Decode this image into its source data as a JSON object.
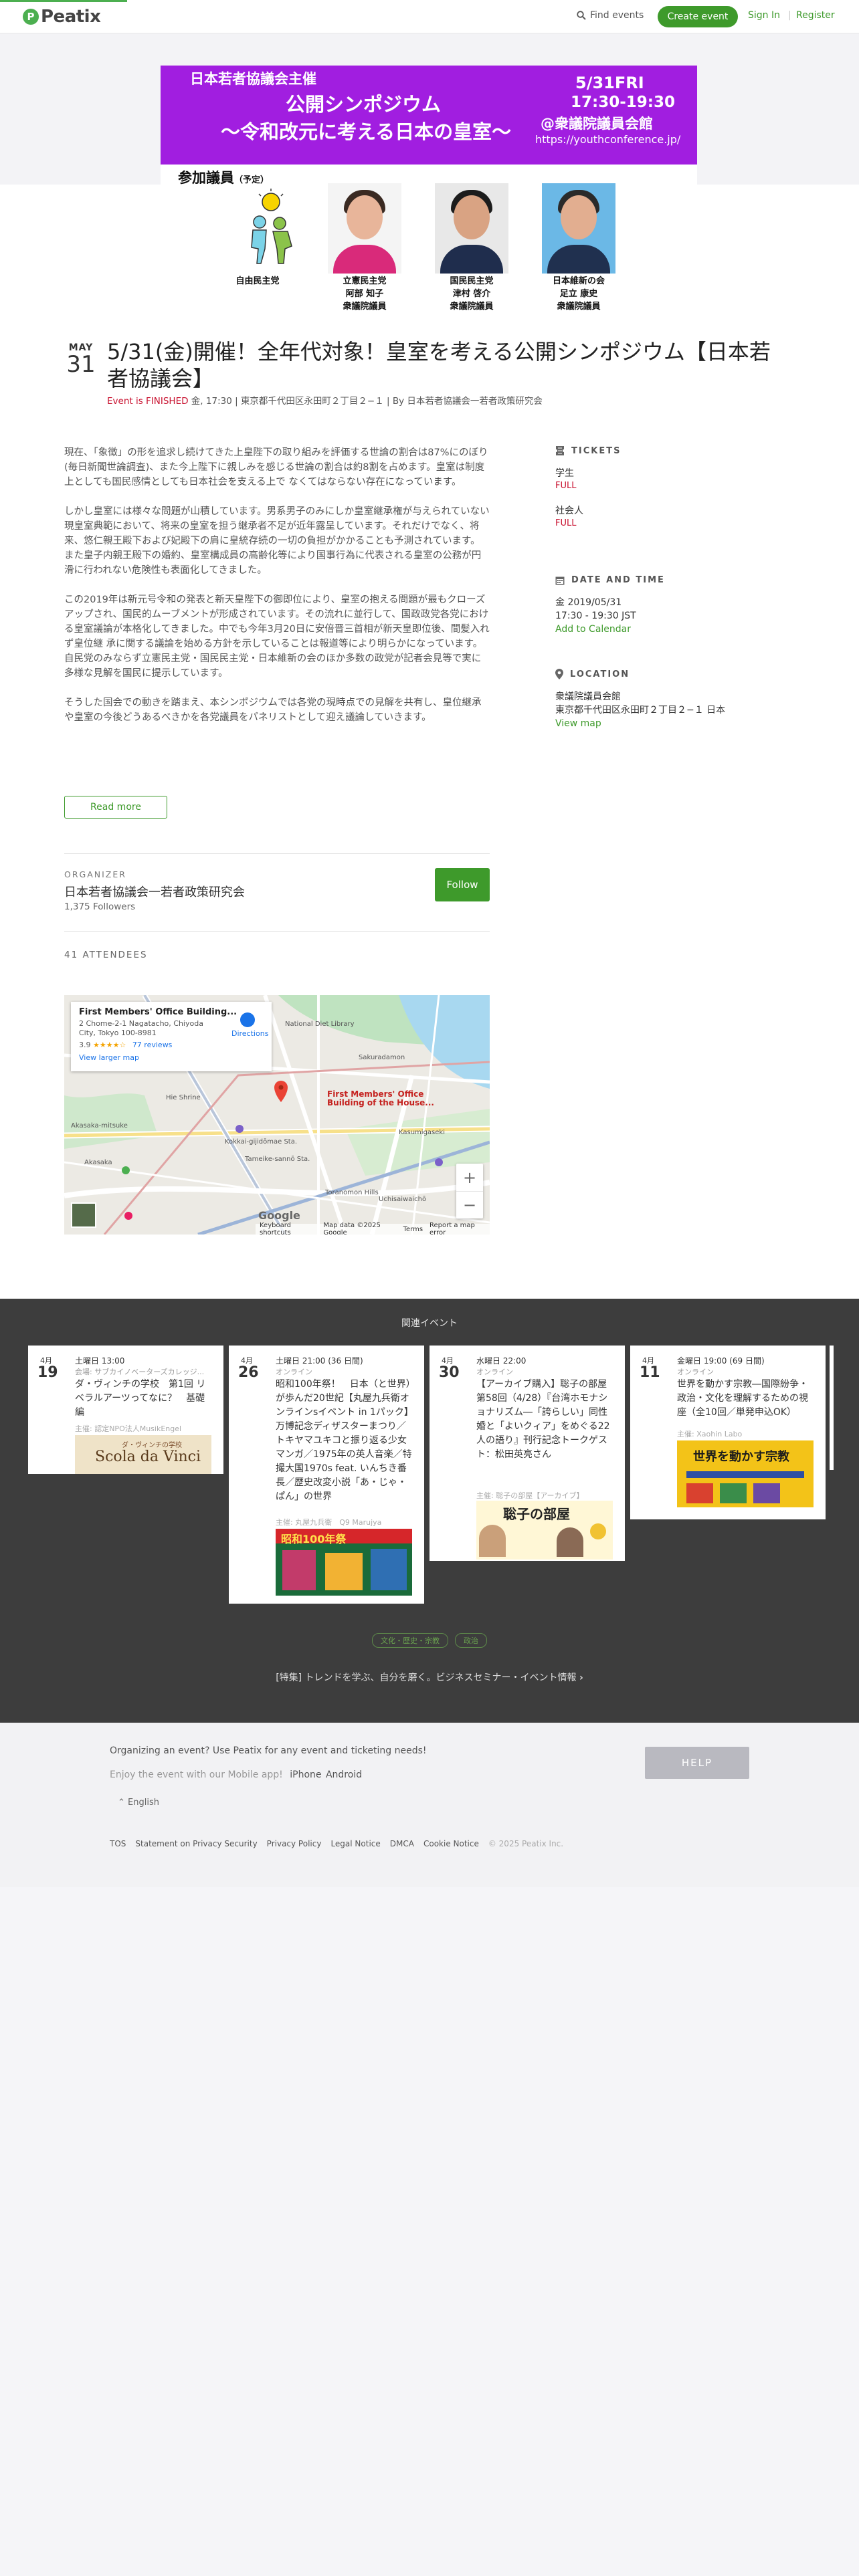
{
  "header": {
    "logo_text": "Peatix",
    "find_events": "Find events",
    "create_event": "Create event",
    "sign_in": "Sign In",
    "separator": "|",
    "register": "Register"
  },
  "banner": {
    "organizer": "日本若者協議会主催",
    "title_line1": "公開シンポジウム",
    "title_line2": "～令和改元に考える日本の皇室～",
    "date": "5/31FRI",
    "time": "17:30-19:30",
    "venue": "@衆議院議員会館",
    "url": "https://youthconference.jp/",
    "members_heading": "参加議員",
    "members_sub": "（予定）",
    "members": [
      {
        "party": "自由民主党",
        "name": "",
        "role": ""
      },
      {
        "party": "立憲民主党",
        "name": "阿部 知子",
        "role": "衆議院議員"
      },
      {
        "party": "国民民主党",
        "name": "津村 啓介",
        "role": "衆議院議員"
      },
      {
        "party": "日本維新の会",
        "name": "足立 康史",
        "role": "衆議院議員"
      }
    ]
  },
  "event": {
    "month": "MAY",
    "day": "31",
    "title": "5/31(金)開催！全年代対象！皇室を考える公開シンポジウム【日本若者協議会】",
    "status": "Event is FINISHED",
    "meta": " 金, 17:30 | 東京都千代田区永田町２丁目２−１ | By 日本若者協議会一若者政策研究会"
  },
  "description": {
    "paragraphs": [
      "現在、「象徴」の形を追求し続けてきた上皇陛下の取り組みを評価する世論の割合は87%にのぼり(毎日新聞世論調査)、また今上陛下に親しみを感じる世論の割合は約8割を占めます。皇室は制度上としても国民感情としても日本社会を支える上で なくてはならない存在になっています。",
      "しかし皇室には様々な問題が山積しています。男系男子のみにしか皇室継承権が与えられていない現皇室典範において、将来の皇室を担う継承者不足が近年露呈しています。それだけでなく、将来、悠仁親王殿下および妃殿下の肩に皇統存続の一切の負担がかかることも予測されています。また皇子内親王殿下の婚約、皇室構成員の高齢化等により国事行為に代表される皇室の公務が円滑に行われない危険性も表面化してきました。",
      "この2019年は新元号令和の発表と新天皇陛下の御即位により、皇室の抱える問題が最もクローズアップされ、国民的ムーブメントが形成されています。その流れに並行して、国政政党各党における皇室議論が本格化してきました。中でも今年3月20日に安倍晋三首相が新天皇即位後、間髪入れず皇位継 承に関する議論を始める方針を示していることは報道等により明らかになっています。自民党のみならず立憲民主党・国民民主党・日本維新の会のほか多数の政党が記者会見等で実に多様な見解を国民に提示しています。",
      "そうした国会での動きを踏まえ、本シンポジウムでは各党の現時点での見解を共有し、皇位継承や皇室の今後どうあるべきかを各党議員をパネリストとして迎え議論していきます。"
    ],
    "read_more": "Read more"
  },
  "sidebar": {
    "tickets_heading": "TICKETS",
    "tickets": [
      {
        "name": "学生",
        "status": "FULL"
      },
      {
        "name": "社会人",
        "status": "FULL"
      }
    ],
    "date_heading": "DATE AND TIME",
    "date_line1": "金 2019/05/31",
    "date_line2": "17:30 - 19:30 JST",
    "add_calendar": "Add to Calendar",
    "location_heading": "LOCATION",
    "location_name": "衆議院議員会館",
    "location_address": "東京都千代田区永田町２丁目２−１ 日本",
    "view_map": "View map"
  },
  "organizer": {
    "label": "ORGANIZER",
    "name": "日本若者協議会一若者政策研究会",
    "followers": "1,375 Followers",
    "follow": "Follow"
  },
  "attendees": "41 ATTENDEES",
  "map": {
    "place_name": "First Members' Office Building...",
    "address_line1": "2 Chome-2-1 Nagatacho, Chiyoda",
    "address_line2": "City, Tokyo 100-8981",
    "rating": "3.9",
    "stars": "★★★★☆",
    "reviews": "77 reviews",
    "larger_map": "View larger map",
    "directions": "Directions",
    "pin_label1": "First Members' Office",
    "pin_label2": "Building of the House...",
    "zoom_in": "+",
    "zoom_out": "−",
    "google": "Google",
    "footer": [
      "Keyboard shortcuts",
      "Map data ©2025 Google",
      "Terms",
      "Report a map error"
    ],
    "places": [
      "National Diet Library",
      "Kasumigaseki",
      "Akasaka",
      "Tameike-sannō Sta.",
      "Kokkai-gijidōmae Sta.",
      "Toranomon Hills",
      "Uchisaiwaichō",
      "Hie Shrine",
      "Sakuradamon",
      "Akasaka-mitsuke"
    ]
  },
  "related": {
    "heading": "関連イベント",
    "cards": [
      {
        "month": "4月",
        "day": "19",
        "time": "土曜日 13:00",
        "location": "会場: サブカイノベーターズカレッジ...",
        "title": "ダ・ヴィンチの学校　第1回 リベラルアーツってなに？　基礎編",
        "organizer": "主催: 認定NPO法人MusikEngel",
        "img_text": "Scola da Vinci",
        "img_sub": "ダ・ヴィンチの学校"
      },
      {
        "month": "4月",
        "day": "26",
        "time": "土曜日 21:00 (36 日間)",
        "location": "オンライン",
        "title": "昭和100年祭！　日本（と世界）が歩んだ20世紀【丸屋九兵衛オンラインsイベント in 1パック】万博記念ディザスターまつり／トキヤマユキコと振り返る少女マンガ／1975年の英人音楽／特撮大国1970s feat. いんちき番長／歴史改変小説「あ・じゃ・ぱん」の世界",
        "organizer": "主催: 丸屋九兵衛　Q9 Marujya",
        "img_text": "昭和100年祭"
      },
      {
        "month": "4月",
        "day": "30",
        "time": "水曜日 22:00",
        "location": "オンライン",
        "title": "【アーカイブ購入】聡子の部屋第58回（4/28）『台湾ホモナショナリズム―「誇らしい」同性婚と「よいクィア」をめぐる22人の語り』刊行記念トークゲスト：松田英亮さん",
        "organizer": "主催: 聡子の部屋【アーカイブ】",
        "img_text": "聡子の部屋"
      },
      {
        "month": "4月",
        "day": "11",
        "time": "金曜日 19:00 (69 日間)",
        "location": "オンライン",
        "title": "世界を動かす宗教―国際紛争・政治・文化を理解するための視座（全10回／単発申込OK）",
        "organizer": "主催: Xaohin Labo",
        "img_text": "世界を動かす宗教"
      }
    ],
    "tags": [
      "文化・歴史・宗教",
      "政治"
    ],
    "bottom_link": "[特集] トレンドを学ぶ、自分を磨く。ビジネスセミナー・イベント情報"
  },
  "footer": {
    "organizing": "Organizing an event? Use Peatix for any event and ticketing needs!",
    "mobile_prefix": "Enjoy the event with our Mobile app!",
    "iphone": "iPhone",
    "android": "Android",
    "help": "HELP",
    "language": "English",
    "links": [
      "TOS",
      "Statement on Privacy Security",
      "Privacy Policy",
      "Legal Notice",
      "DMCA",
      "Cookie Notice"
    ],
    "copyright": "© 2025 Peatix Inc."
  },
  "colors": {
    "accent_green": "#3e9a2b",
    "banner_purple": "#a11ee0",
    "finished_red": "#c8102e",
    "related_bg": "#3d3d3d"
  }
}
